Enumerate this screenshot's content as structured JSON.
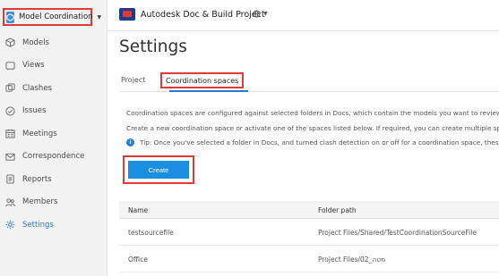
{
  "header": {
    "module_label": "Model Coordination",
    "project_name": "Autodesk Doc & Build Project",
    "globe_icon": "globe-icon"
  },
  "sidebar": {
    "items": [
      {
        "label": "Models",
        "icon": "cube-icon"
      },
      {
        "label": "Views",
        "icon": "views-icon"
      },
      {
        "label": "Clashes",
        "icon": "clashes-icon"
      },
      {
        "label": "Issues",
        "icon": "check-circle-icon"
      },
      {
        "label": "Meetings",
        "icon": "calendar-icon"
      },
      {
        "label": "Correspondence",
        "icon": "mail-icon"
      },
      {
        "label": "Reports",
        "icon": "report-icon"
      },
      {
        "label": "Members",
        "icon": "members-icon"
      },
      {
        "label": "Settings",
        "icon": "gear-icon",
        "active": true
      }
    ]
  },
  "main": {
    "title": "Settings",
    "tabs": [
      {
        "label": "Project"
      },
      {
        "label": "Coordination spaces",
        "active": true
      }
    ],
    "description_1": "Coordination spaces are configured against selected folders in Docs, which contain the models you want to review an",
    "description_2": "Create a new coordination space or activate one of the spaces listed below. If required, you can create multiple space",
    "tip": "Tip: Once you've selected a folder in Docs, and turned clash detection on or off for a coordination space, these se",
    "create_label": "Create"
  },
  "table": {
    "columns": [
      "Name",
      "Folder path"
    ],
    "rows": [
      {
        "name": "testsourcefile",
        "path": "Project Files/Shared/TestCoordinationSourceFile"
      },
      {
        "name": "Office",
        "path": "Project Files/02_מטה"
      }
    ]
  },
  "colors": {
    "accent": "#2b7bd0",
    "highlight": "#e23a3a",
    "button": "#1a8ee0"
  }
}
